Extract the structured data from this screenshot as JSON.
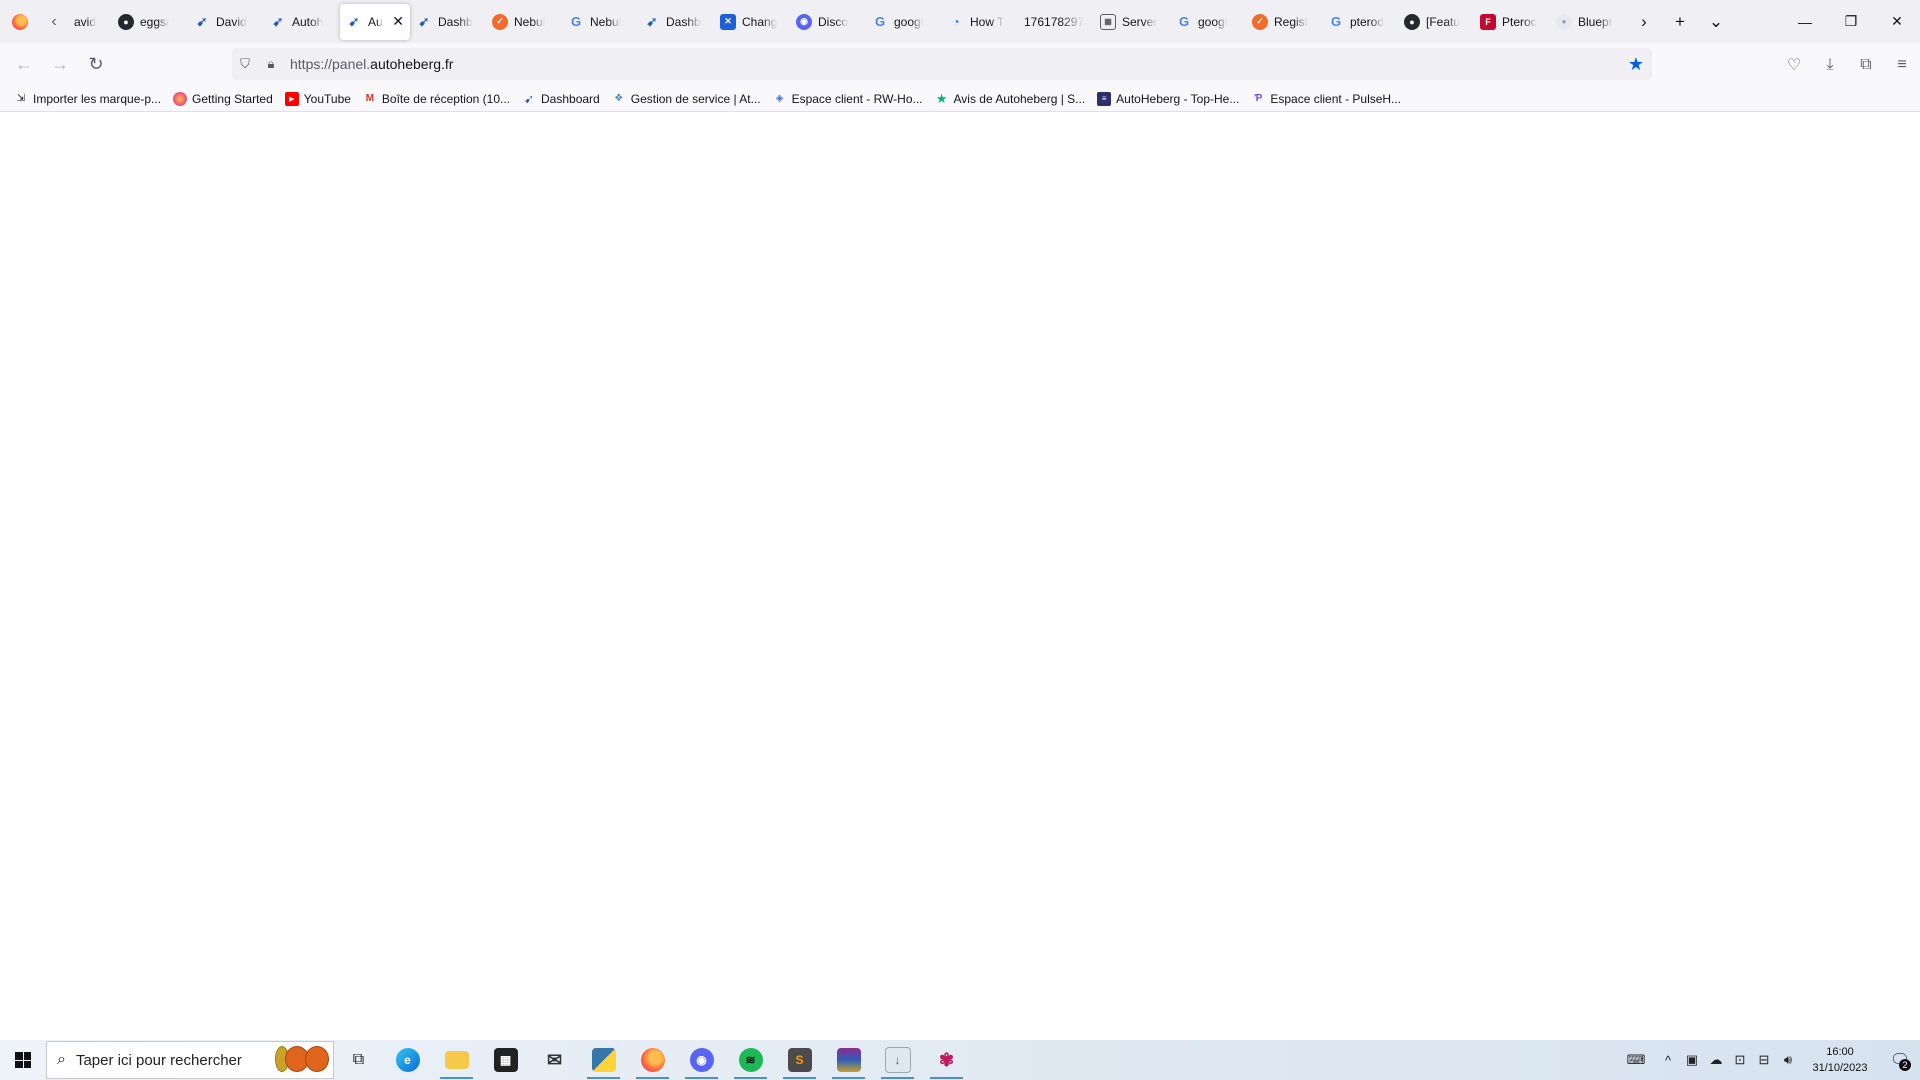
{
  "tabs": [
    {
      "label": "avid",
      "icon": "blank"
    },
    {
      "label": "eggs/",
      "icon": "github-icon"
    },
    {
      "label": "David",
      "icon": "autoheberg-icon"
    },
    {
      "label": "Autoh",
      "icon": "autoheberg-icon"
    },
    {
      "label": "Au",
      "icon": "autoheberg-icon",
      "active": true
    },
    {
      "label": "Dashb",
      "icon": "autoheberg-icon"
    },
    {
      "label": "Nebul",
      "icon": "nebula-icon"
    },
    {
      "label": "Nebul",
      "icon": "google-icon"
    },
    {
      "label": "Dashb",
      "icon": "autoheberg-icon"
    },
    {
      "label": "Chang",
      "icon": "changelog-icon"
    },
    {
      "label": "Disco",
      "icon": "discord-icon"
    },
    {
      "label": "googl",
      "icon": "google-icon"
    },
    {
      "label": "How T",
      "icon": "howto-icon"
    },
    {
      "label": "176178297",
      "icon": "blank"
    },
    {
      "label": "Server",
      "icon": "server-icon"
    },
    {
      "label": "googl",
      "icon": "google-icon"
    },
    {
      "label": "Regist",
      "icon": "nebula-icon"
    },
    {
      "label": "pterod",
      "icon": "google-icon"
    },
    {
      "label": "[Featu",
      "icon": "github-icon"
    },
    {
      "label": "Pteroc",
      "icon": "pterodactyl-icon"
    },
    {
      "label": "Bluepr",
      "icon": "blueprint-icon"
    }
  ],
  "nav": {
    "url_prefix": "https://panel.",
    "url_domain": "autoheberg.fr"
  },
  "bookmarks": [
    {
      "label": "Importer les marque-p...",
      "icon": "import-icon"
    },
    {
      "label": "Getting Started",
      "icon": "firefox-icon"
    },
    {
      "label": "YouTube",
      "icon": "youtube-icon"
    },
    {
      "label": "Boîte de réception (10...",
      "icon": "gmail-icon"
    },
    {
      "label": "Dashboard",
      "icon": "autoheberg-icon"
    },
    {
      "label": "Gestion de service | At...",
      "icon": "service-icon"
    },
    {
      "label": "Espace client - RW-Ho...",
      "icon": "rw-host-icon"
    },
    {
      "label": "Avis de Autoheberg | S...",
      "icon": "trustpilot-star-icon"
    },
    {
      "label": "AutoHeberg - Top-He...",
      "icon": "top-heberg-icon"
    },
    {
      "label": "Espace client - PulseH...",
      "icon": "pulse-icon"
    }
  ],
  "taskbar": {
    "search_placeholder": "Taper ici pour rechercher",
    "apps": [
      "task-view-icon",
      "edge-icon",
      "file-explorer-icon",
      "store-icon",
      "mail-icon",
      "python-icon",
      "firefox-icon",
      "discord-icon",
      "spotify-icon",
      "sublime-icon",
      "winrar-icon",
      "installer-icon",
      "xbox-icon"
    ],
    "time": "16:00",
    "date": "31/10/2023",
    "notification_count": "2"
  },
  "colors": {
    "accent": "#0061e0",
    "tabbar_bg": "#f0f0f4",
    "toolbar_bg": "#f9f9fb"
  }
}
